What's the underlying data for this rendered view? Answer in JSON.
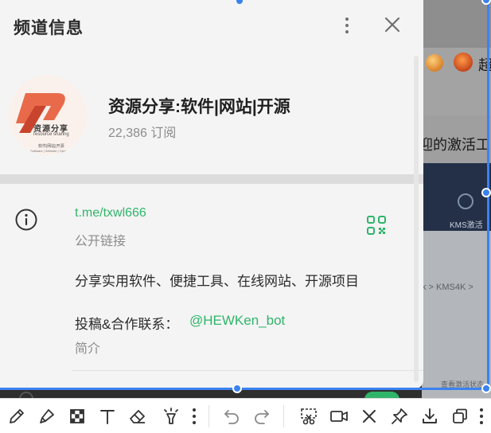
{
  "panel": {
    "title": "频道信息",
    "channel_name": "资源分享:软件|网站|开源",
    "subscribers": "22,386 订阅",
    "avatar": {
      "text_cn": "资源分享",
      "text_en": "resource sharing",
      "tagline": "软件|网站|开源",
      "tagline_en": "Software | Website | Open Source"
    },
    "link": "t.me/txwl666",
    "link_label": "公开链接",
    "description": "分享实用软件、便捷工具、在线网站、开源项目",
    "contact_label": "投稿&合作联系：",
    "contact_bot": "@HEWKen_bot",
    "intro_label": "简介"
  },
  "background_app": {
    "chao": "超",
    "activate_text": "迎的激活工",
    "kms_label": "KMS激活",
    "breadcrumb": "k > KMS4K >",
    "status": "查看激活状态"
  },
  "colors": {
    "accent_green": "#2fb56a",
    "selection_blue": "#3b82f0",
    "panel_bg": "#f4f4f4"
  },
  "toolbar": {
    "tools": [
      "pen-icon",
      "highlighter-icon",
      "mosaic-icon",
      "text-icon",
      "eraser-icon",
      "spotlight-icon"
    ],
    "history": [
      "undo-icon",
      "redo-icon"
    ],
    "actions": [
      "screenshot-cut-icon",
      "record-video-icon",
      "close-icon",
      "pin-icon",
      "download-icon",
      "copy-icon"
    ]
  }
}
